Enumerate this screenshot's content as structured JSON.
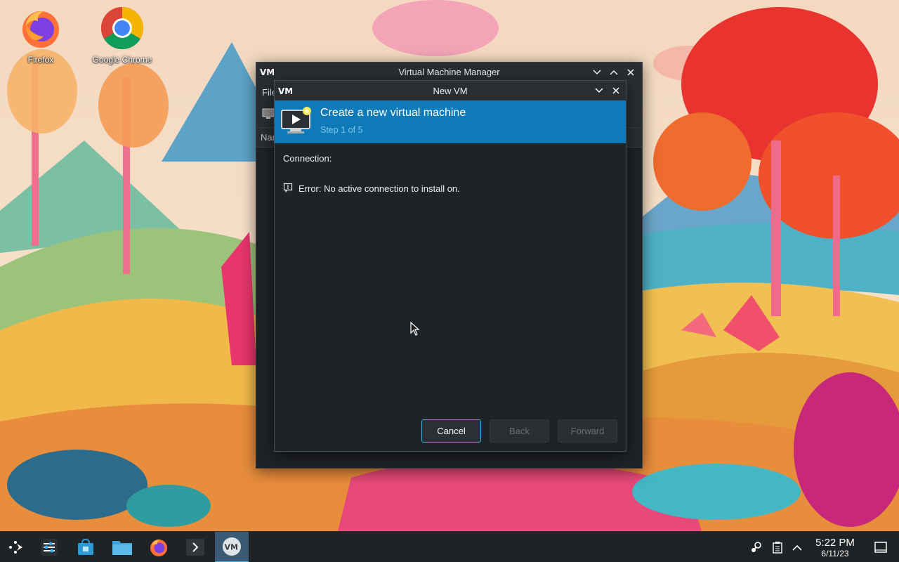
{
  "desktop": {
    "icons": [
      {
        "label": "Firefox",
        "icon": "firefox-icon"
      },
      {
        "label": "Google Chrome",
        "icon": "chrome-icon"
      }
    ]
  },
  "main_window": {
    "title": "Virtual Machine Manager",
    "menu_partial": "File",
    "list_header_partial": "Name",
    "app_icon": "virt-manager-icon"
  },
  "dialog": {
    "title": "New VM",
    "banner_title": "Create a new virtual machine",
    "banner_step": "Step 1 of 5",
    "connection_label": "Connection:",
    "error_text": "Error: No active connection to install on.",
    "buttons": {
      "cancel": "Cancel",
      "back": "Back",
      "forward": "Forward"
    },
    "banner_color": "#0e7bb8"
  },
  "taskbar": {
    "items": [
      "application-launcher-icon",
      "system-settings-icon",
      "discover-store-icon",
      "file-manager-icon",
      "firefox-icon",
      "terminal-icon",
      "virt-manager-icon"
    ],
    "active_item": "virt-manager-icon",
    "clock": {
      "time": "5:22 PM",
      "date": "6/11/23"
    },
    "tray": [
      "steam-icon",
      "clipboard-icon",
      "tray-expand-icon",
      "show-desktop-icon"
    ]
  },
  "colors": {
    "accent": "#3daee9",
    "panel": "#202326"
  }
}
